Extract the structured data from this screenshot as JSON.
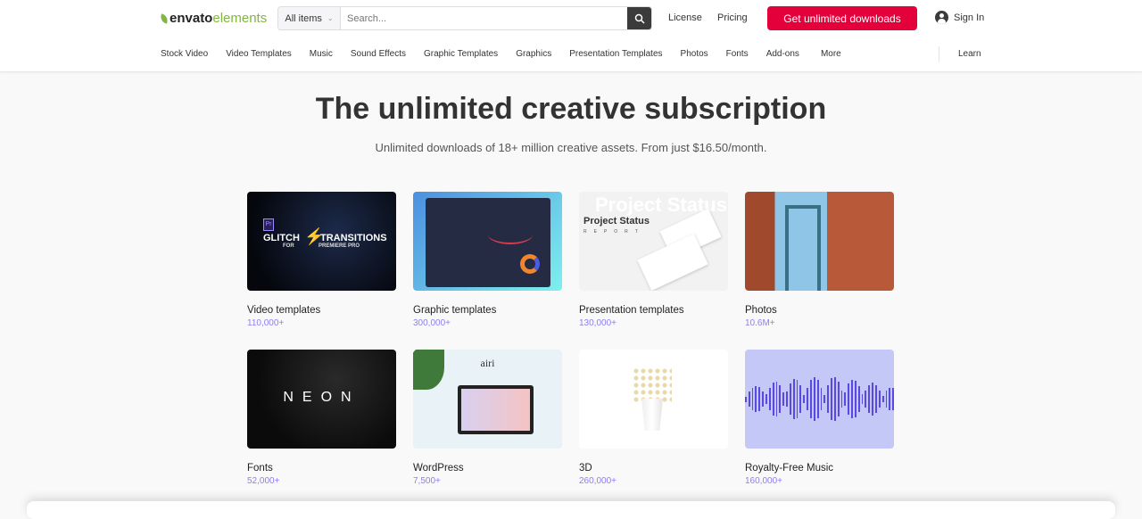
{
  "header": {
    "logo": {
      "brand": "envato",
      "product": "elements"
    },
    "search": {
      "category": "All items",
      "placeholder": "Search..."
    },
    "links": [
      "License",
      "Pricing"
    ],
    "cta": "Get unlimited downloads",
    "sign_in": "Sign In"
  },
  "nav": {
    "items": [
      "Stock Video",
      "Video Templates",
      "Music",
      "Sound Effects",
      "Graphic Templates",
      "Graphics",
      "Presentation Templates",
      "Photos",
      "Fonts",
      "Add-ons",
      "More"
    ],
    "learn": "Learn"
  },
  "hero": {
    "title": "The unlimited creative subscription",
    "subtitle": "Unlimited downloads of 18+ million creative assets. From just $16.50/month."
  },
  "categories": [
    {
      "label": "Video templates",
      "count": "110,000+",
      "thumb_text": {
        "a": "GLITCH",
        "b": "TRANSITIONS",
        "c": "FOR",
        "d": "PREMIERE PRO",
        "e": "Pr"
      }
    },
    {
      "label": "Graphic templates",
      "count": "300,000+"
    },
    {
      "label": "Presentation templates",
      "count": "130,000+",
      "thumb_text": {
        "a": "Project Status",
        "b": "REPORT",
        "c": "Project Status"
      }
    },
    {
      "label": "Photos",
      "count": "10.6M+"
    },
    {
      "label": "Fonts",
      "count": "52,000+",
      "thumb_text": {
        "a": "NEON"
      }
    },
    {
      "label": "WordPress",
      "count": "7,500+",
      "thumb_text": {
        "a": "airi"
      }
    },
    {
      "label": "3D",
      "count": "260,000+"
    },
    {
      "label": "Royalty-Free Music",
      "count": "160,000+"
    }
  ],
  "colors": {
    "accent": "#e4003a",
    "brand_green": "#82b541",
    "count": "#8c7ef5"
  }
}
